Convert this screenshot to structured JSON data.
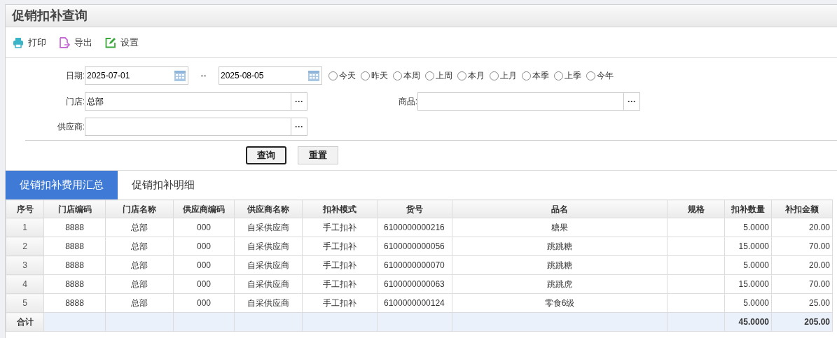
{
  "title": "促销扣补查询",
  "toolbar": [
    {
      "label": "打印",
      "kind": "print"
    },
    {
      "label": "导出",
      "kind": "export"
    },
    {
      "label": "设置",
      "kind": "settings"
    }
  ],
  "filters": {
    "date": {
      "label": "日期:",
      "from": "2025-07-01",
      "separator": "--",
      "to": "2025-08-05"
    },
    "quick_ranges": [
      {
        "label": "今天",
        "selected": false
      },
      {
        "label": "昨天",
        "selected": false
      },
      {
        "label": "本周",
        "selected": false
      },
      {
        "label": "上周",
        "selected": false
      },
      {
        "label": "本月",
        "selected": false
      },
      {
        "label": "上月",
        "selected": false
      },
      {
        "label": "本季",
        "selected": false
      },
      {
        "label": "上季",
        "selected": false
      },
      {
        "label": "今年",
        "selected": false
      }
    ],
    "store": {
      "label": "门店:",
      "value": "总部",
      "button": "···"
    },
    "product": {
      "label": "商品:",
      "button": "···"
    },
    "supplier": {
      "label": "供应商:",
      "button": "···"
    }
  },
  "buttons": [
    {
      "label": "查询",
      "kind": "primary"
    },
    {
      "label": "重置",
      "kind": "secondary"
    }
  ],
  "tabs": [
    {
      "label": "促销扣补费用汇总",
      "selected": true
    },
    {
      "label": "促销扣补明细",
      "selected": false
    }
  ],
  "table": {
    "columns": [
      "序号",
      "门店编码",
      "门店名称",
      "供应商编码",
      "供应商名称",
      "扣补模式",
      "货号",
      "品名",
      "规格",
      "扣补数量",
      "补扣金额"
    ],
    "rows": [
      [
        "1",
        "8888",
        "总部",
        "000",
        "自采供应商",
        "手工扣补",
        "6100000000216",
        "糖果",
        null,
        "5.0000",
        "20.00"
      ],
      [
        "2",
        "8888",
        "总部",
        "000",
        "自采供应商",
        "手工扣补",
        "6100000000056",
        "跳跳糖",
        null,
        "15.0000",
        "70.00"
      ],
      [
        "3",
        "8888",
        "总部",
        "000",
        "自采供应商",
        "手工扣补",
        "6100000000070",
        "跳跳糖",
        null,
        "5.0000",
        "20.00"
      ],
      [
        "4",
        "8888",
        "总部",
        "000",
        "自采供应商",
        "手工扣补",
        "6100000000063",
        "跳跳虎",
        null,
        "15.0000",
        "70.00"
      ],
      [
        "5",
        "8888",
        "总部",
        "000",
        "自采供应商",
        "手工扣补",
        "6100000000124",
        "零食6级",
        null,
        "5.0000",
        "25.00"
      ]
    ],
    "totals": {
      "label": "合计",
      "quantity": "45.0000",
      "amount": "205.00"
    }
  }
}
